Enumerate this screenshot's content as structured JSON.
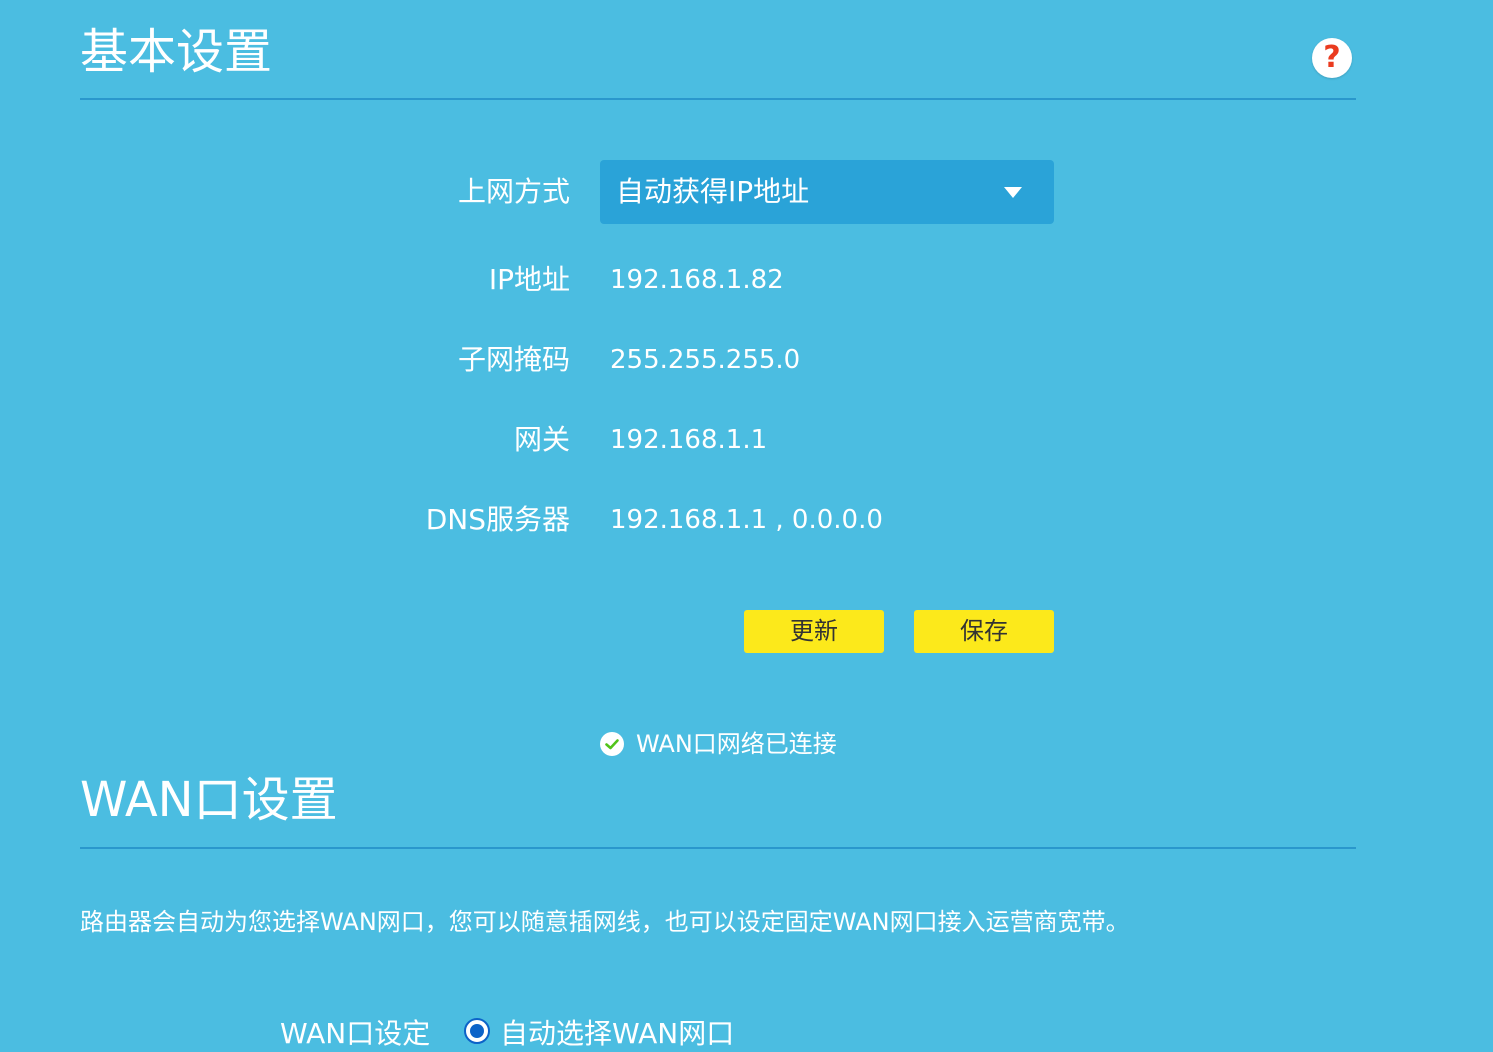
{
  "basic_settings": {
    "title": "基本设置",
    "help_icon": "question-mark-icon",
    "help_symbol": "?",
    "connection_type": {
      "label": "上网方式",
      "selected": "自动获得IP地址"
    },
    "fields": [
      {
        "label": "IP地址",
        "value": "192.168.1.82"
      },
      {
        "label": "子网掩码",
        "value": "255.255.255.0"
      },
      {
        "label": "网关",
        "value": "192.168.1.1"
      },
      {
        "label": "DNS服务器",
        "value": "192.168.1.1 , 0.0.0.0"
      }
    ],
    "buttons": {
      "refresh": "更新",
      "save": "保存"
    },
    "status": {
      "icon": "check-circle-icon",
      "text": "WAN口网络已连接"
    }
  },
  "wan_settings": {
    "title": "WAN口设置",
    "description": "路由器会自动为您选择WAN网口，您可以随意插网线，也可以设定固定WAN网口接入运营商宽带。",
    "port_setting": {
      "label": "WAN口设定",
      "selected_option": "自动选择WAN网口"
    }
  },
  "colors": {
    "background": "#4bbde1",
    "divider": "#2a97cc",
    "select_bg": "#2aa3d8",
    "button_bg": "#fce91b",
    "status_check": "#52c41a",
    "help_icon": "#ea3b1f",
    "radio_accent": "#0c63c8"
  }
}
